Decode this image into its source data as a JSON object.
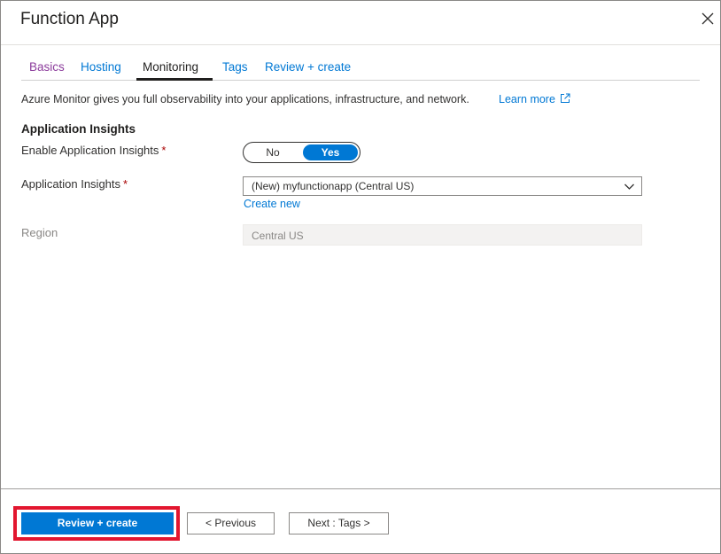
{
  "header": {
    "title": "Function App",
    "close_icon": "close-icon"
  },
  "tabs": [
    {
      "label": "Basics"
    },
    {
      "label": "Hosting"
    },
    {
      "label": "Monitoring"
    },
    {
      "label": "Tags"
    },
    {
      "label": "Review + create"
    }
  ],
  "intro": {
    "text": "Azure Monitor gives you full observability into your applications, infrastructure, and network.",
    "link": "Learn more",
    "link_icon": "external-link-icon"
  },
  "app_insights": {
    "section_title": "Application Insights",
    "enable_label": "Enable Application Insights",
    "required_mark": "*",
    "toggle_off": "No",
    "toggle_on": "Yes",
    "toggle_selected": "Yes",
    "resource_label": "Application Insights",
    "resource_value": "(New) myfunctionapp  (Central US)",
    "create_new": "Create new",
    "region_label": "Region",
    "region_value": "Central US"
  },
  "footer": {
    "review_create": "Review + create",
    "previous": "< Previous",
    "next": "Next : Tags >"
  },
  "colors": {
    "accent": "#0078d4",
    "visited_link": "#8b3b9b",
    "highlight": "#e2162f",
    "required": "#a80000"
  }
}
